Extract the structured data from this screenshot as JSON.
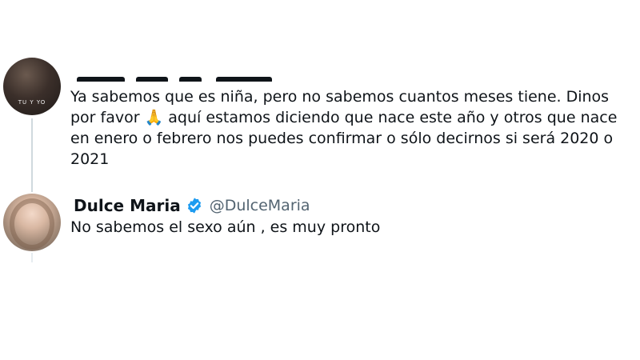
{
  "reply_tweet": {
    "avatar_caption": "TU Y YO",
    "text": "Ya sabemos que es niña, pero no sabemos cuantos meses tiene. Dinos por favor 🙏 aquí estamos diciendo que nace este año y otros que nace en enero o febrero nos puedes confirmar o sólo decirnos si será 2020 o 2021"
  },
  "response_tweet": {
    "name": "Dulce Maria",
    "handle": "@DulceMaria",
    "text": "No sabemos el sexo aún , es muy pronto"
  },
  "colors": {
    "text": "#0f1419",
    "handle": "#536471",
    "verified": "#1d9bf0",
    "thread_line": "#cfd9de"
  },
  "icons": {
    "verified_badge": "verified-check-icon",
    "emoji": "folded-hands"
  }
}
